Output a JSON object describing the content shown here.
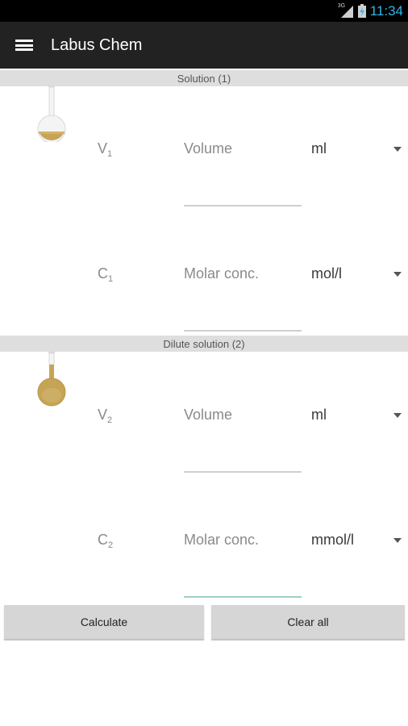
{
  "status_bar": {
    "network_label": "3G",
    "time": "11:34"
  },
  "action_bar": {
    "title": "Labus Chem",
    "menu_icon": "hamburger-menu-icon"
  },
  "colors": {
    "accent": "#33b5e5",
    "action_bar_bg": "#222222",
    "section_header_bg": "#dedede",
    "flask_liquid": "#c7a455",
    "focused_underline": "#9ccfc6"
  },
  "solution1": {
    "header": "Solution (1)",
    "flask_icon": "volumetric-flask-icon",
    "volume": {
      "symbol": "V",
      "subscript": "1",
      "placeholder": "Volume",
      "unit": "ml"
    },
    "concentration": {
      "symbol": "C",
      "subscript": "1",
      "placeholder": "Molar conc.",
      "unit": "mol/l"
    }
  },
  "solution2": {
    "header": "Dilute solution (2)",
    "flask_icon": "volumetric-flask-icon",
    "volume": {
      "symbol": "V",
      "subscript": "2",
      "placeholder": "Volume",
      "unit": "ml"
    },
    "concentration": {
      "symbol": "C",
      "subscript": "2",
      "placeholder": "Molar conc.",
      "unit": "mmol/l"
    }
  },
  "buttons": {
    "calculate": "Calculate",
    "clear_all": "Clear all"
  }
}
